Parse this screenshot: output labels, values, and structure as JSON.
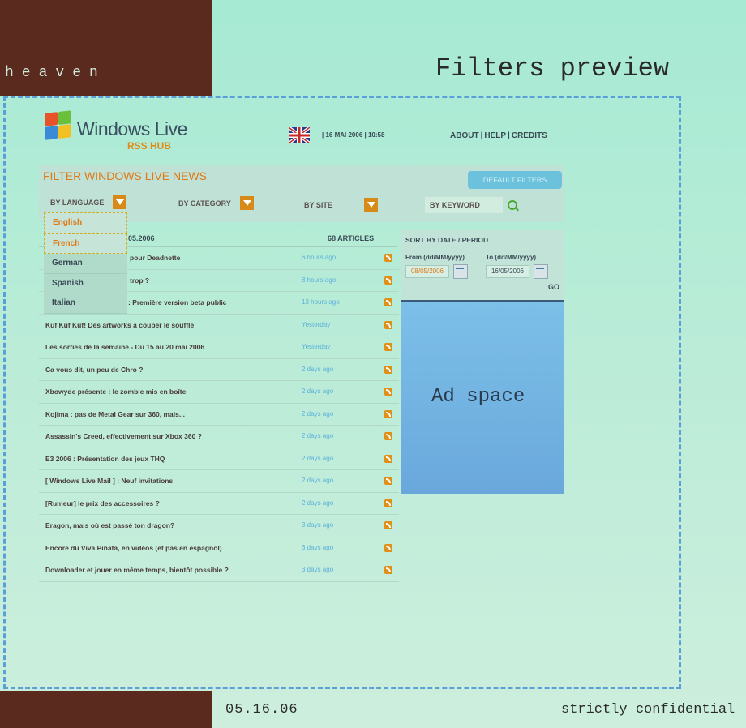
{
  "slide": {
    "side_label": "heaven",
    "title": "Filters preview",
    "footer_date": "05.16.06",
    "footer_note": "strictly confidential"
  },
  "header": {
    "logo_text": "Windows Live",
    "logo_sub": "RSS HUB",
    "date": "| 16 MAI 2006 | 10:58",
    "nav": [
      "ABOUT",
      "HELP",
      "CREDITS"
    ]
  },
  "filter": {
    "title": "FILTER WINDOWS LIVE NEWS",
    "default_button": "DEFAULT FILTERS",
    "by_language": "BY LANGUAGE",
    "by_category": "BY CATEGORY",
    "by_site": "BY SITE",
    "by_keyword": "BY KEYWORD",
    "languages": [
      "English",
      "French",
      "German",
      "Spanish",
      "Italian"
    ]
  },
  "list": {
    "header_left": "05.2006",
    "article_count": "68 ARTICLES",
    "rows": [
      {
        "title": "pour Deadnette",
        "time": "6 hours ago"
      },
      {
        "title": "trop ?",
        "time": "8 hours ago"
      },
      {
        "title": ": Première version beta public",
        "time": "13 hours ago"
      },
      {
        "title": "Kuf Kuf Kuf! Des artworks à couper le souffle",
        "time": "Yesterday"
      },
      {
        "title": "Les sorties de la semaine - Du 15 au 20 mai 2006",
        "time": "Yesterday"
      },
      {
        "title": "Ca vous dit, un peu de Chro ?",
        "time": "2 days ago"
      },
      {
        "title": "Xbowyde présente : le zombie mis en boîte",
        "time": "2 days ago"
      },
      {
        "title": "Kojima : pas de Metal Gear sur 360, mais...",
        "time": "2 days ago"
      },
      {
        "title": "Assassin's Creed, effectivement sur Xbox 360 ?",
        "time": "2 days ago"
      },
      {
        "title": "E3 2006 : Présentation des jeux THQ",
        "time": "2 days ago"
      },
      {
        "title": "[ Windows Live Mail ] : Neuf invitations",
        "time": "2 days ago"
      },
      {
        "title": "[Rumeur] le prix des accessoires ?",
        "time": "2 days ago"
      },
      {
        "title": "Eragon, mais où est passé ton dragon?",
        "time": "3 days ago"
      },
      {
        "title": "Encore du Viva Piñata, en vidéos (et pas en espagnol)",
        "time": "3 days ago"
      },
      {
        "title": "Downloader et jouer en même temps, bientôt possible ?",
        "time": "3 days ago"
      }
    ]
  },
  "sort": {
    "title": "SORT BY DATE / PERIOD",
    "from_label": "From (dd/MM/yyyy)",
    "to_label": "To (dd/MM/yyyy)",
    "from_value": "08/05/2006",
    "to_value": "16/05/2006",
    "go": "GO"
  },
  "ad": {
    "text": "Ad space"
  },
  "colors": {
    "accent": "#e07814",
    "link": "#5ab0da",
    "ad": "#7cc0e8"
  }
}
